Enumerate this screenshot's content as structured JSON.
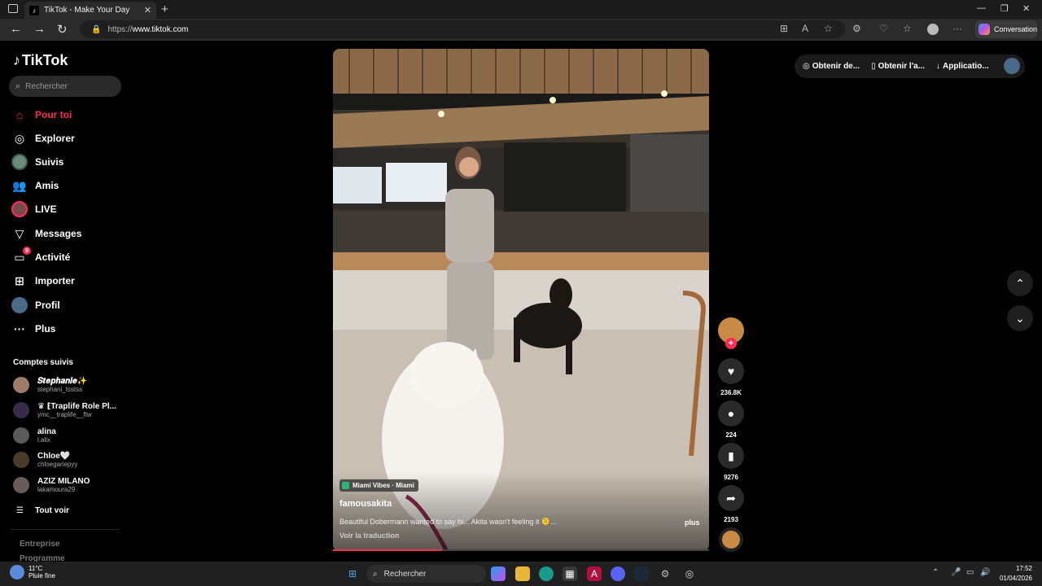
{
  "browser": {
    "tab_title": "TikTok - Make Your Day",
    "url_scheme": "https://",
    "url_host": "www.tiktok.com",
    "copilot_label": "Conversation"
  },
  "sidebar": {
    "logo": "TikTok",
    "search_placeholder": "Rechercher",
    "nav": [
      {
        "label": "Pour toi",
        "icon": "home-icon"
      },
      {
        "label": "Explorer",
        "icon": "compass-icon"
      },
      {
        "label": "Suivis",
        "icon": "following-avatar-icon"
      },
      {
        "label": "Amis",
        "icon": "friends-icon"
      },
      {
        "label": "LIVE",
        "icon": "live-icon"
      },
      {
        "label": "Messages",
        "icon": "messages-icon"
      },
      {
        "label": "Activité",
        "icon": "activity-icon",
        "badge": "9"
      },
      {
        "label": "Importer",
        "icon": "upload-icon"
      },
      {
        "label": "Profil",
        "icon": "profile-icon"
      },
      {
        "label": "Plus",
        "icon": "more-icon"
      }
    ],
    "followed_title": "Comptes suivis",
    "followed": [
      {
        "name": "𝑺𝒕𝒆𝒑𝒉𝒂𝒏𝒊𝒆✨",
        "user": "stephani_tsstss"
      },
      {
        "name": "♛ ⁅Traplife Role Pl...",
        "user": "ymc__traplife__ftw"
      },
      {
        "name": "alina",
        "user": "l.alix"
      },
      {
        "name": "Chloe🤍",
        "user": "chloegariepyy"
      },
      {
        "name": "AZIZ MILANO",
        "user": "lakamoura29"
      }
    ],
    "see_all": "Tout voir",
    "footer": [
      "Entreprise",
      "Programme"
    ]
  },
  "video": {
    "location": "Miami Vibes · Miami",
    "author": "famousakita",
    "description": "Beautiful Dobermann wanted to say hi... Akita wasn't feeling it 🫠...",
    "more": "plus",
    "translate": "Voir la traduction",
    "progress": 0.29
  },
  "actions": {
    "likes": "236.8K",
    "comments": "224",
    "saves": "9276",
    "shares": "2193"
  },
  "topbar": {
    "item1": "Obtenir de...",
    "item2": "Obtenir l'a...",
    "item3": "Applicatio..."
  },
  "taskbar": {
    "temp": "11°C",
    "weather": "Pluie fine",
    "search": "Rechercher",
    "time": "17:52",
    "date": "01/04/2026"
  }
}
